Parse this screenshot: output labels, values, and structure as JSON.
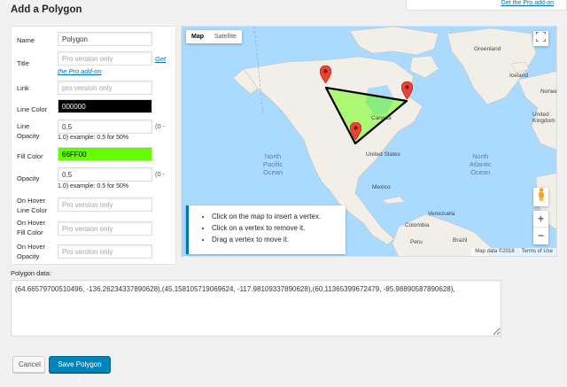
{
  "page": {
    "title": "Add a Polygon",
    "top_notice_link": "Get the Pro add-on"
  },
  "form": {
    "name": {
      "label": "Name",
      "value": "Polygon"
    },
    "title": {
      "label": "Title",
      "placeholder": "Pro version only",
      "get_link": "Get",
      "pro_link": "the Pro add-on"
    },
    "link": {
      "label": "Link",
      "placeholder": "pro version only"
    },
    "line_color": {
      "label": "Line Color",
      "value": "000000"
    },
    "line_opacity": {
      "label_1": "Line",
      "label_2": "Opacity",
      "value": "0.5",
      "suffix": "(0 -",
      "hint": "1.0) example: 0.5 for 50%"
    },
    "fill_color": {
      "label": "Fill Color",
      "value": "66FF00"
    },
    "opacity": {
      "label": "Opacity",
      "value": "0.5",
      "suffix": "(0 -",
      "hint": "1.0) example: 0.5 for 50%"
    },
    "hover_line_color": {
      "label_1": "On Hover",
      "label_2": "Line Color",
      "placeholder": "Pro version only"
    },
    "hover_fill_color": {
      "label_1": "On Hover",
      "label_2": "Fill Color",
      "placeholder": "Pro version only"
    },
    "hover_opacity": {
      "label_1": "On Hover",
      "label_2": "Opacity",
      "placeholder": "Pro version only"
    }
  },
  "map": {
    "map_type": {
      "map": "Map",
      "satellite": "Satellite"
    },
    "labels": {
      "greenland": "Greenland",
      "canada": "Canada",
      "united_states": "United States",
      "mexico": "Mexico",
      "north_pacific": "North",
      "north_pacific_2": "Pacific",
      "north_pacific_3": "Ocean",
      "north_atlantic": "North",
      "north_atlantic_2": "Atlantic",
      "north_atlantic_3": "Ocean",
      "venezuela": "Venezuela",
      "colombia": "Colombia",
      "brazil": "Brazil",
      "peru": "Peru",
      "iceland": "Iceland",
      "norway": "Norwa",
      "uk": "United\nKingdom"
    },
    "footer": {
      "data": "Map data ©2018",
      "terms": "Terms of Use"
    },
    "instructions": [
      "Click on the map to insert a vertex.",
      "Click on a vertex to remove it.",
      "Drag a vertex to move it."
    ],
    "zoom_in": "+",
    "zoom_out": "−",
    "polygon_fill": "#66ff00",
    "polygon_line": "#000000"
  },
  "polygon_data": {
    "label": "Polygon data:",
    "value": "(64.66579700510496, -136.26234337890628),(45.158105719069624, -117.98109337890628),(60.11365399672479, -85.98890587890628),"
  },
  "buttons": {
    "cancel": "Cancel",
    "save": "Save Polygon »"
  }
}
